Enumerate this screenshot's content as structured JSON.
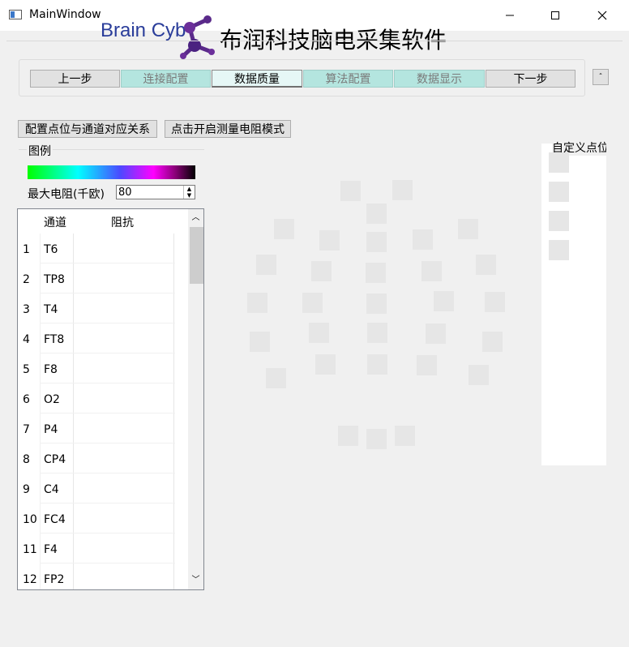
{
  "window": {
    "title": "MainWindow",
    "logo_text": "Brain Cyb",
    "app_heading": "布润科技脑电采集软件"
  },
  "steps": [
    {
      "label": "上一步"
    },
    {
      "label": "连接配置"
    },
    {
      "label": "数据质量"
    },
    {
      "label": "算法配置"
    },
    {
      "label": "数据显示"
    },
    {
      "label": "下一步"
    }
  ],
  "toolbar": {
    "config_button": "配置点位与通道对应关系",
    "impedance_button": "点击开启测量电阻模式",
    "small_button": "ˆ"
  },
  "legend": {
    "title": "图例",
    "max_label": "最大电阻(千欧)",
    "max_value": "80"
  },
  "table": {
    "headers": [
      "通道",
      "阻抗"
    ],
    "rows": [
      {
        "num": "1",
        "channel": "T6",
        "impedance": ""
      },
      {
        "num": "2",
        "channel": "TP8",
        "impedance": ""
      },
      {
        "num": "3",
        "channel": "T4",
        "impedance": ""
      },
      {
        "num": "4",
        "channel": "FT8",
        "impedance": ""
      },
      {
        "num": "5",
        "channel": "F8",
        "impedance": ""
      },
      {
        "num": "6",
        "channel": "O2",
        "impedance": ""
      },
      {
        "num": "7",
        "channel": "P4",
        "impedance": ""
      },
      {
        "num": "8",
        "channel": "CP4",
        "impedance": ""
      },
      {
        "num": "9",
        "channel": "C4",
        "impedance": ""
      },
      {
        "num": "10",
        "channel": "FC4",
        "impedance": ""
      },
      {
        "num": "11",
        "channel": "F4",
        "impedance": ""
      },
      {
        "num": "12",
        "channel": "FP2",
        "impedance": ""
      }
    ]
  },
  "custom_points": {
    "title": "自定义点位"
  },
  "colors": {
    "tab_inactive": "#b4e5df",
    "tab_active": "#e6f7f6",
    "electrode": "#e6e6e6",
    "logo": "#2a3d9a",
    "logo_mark": "#5a2a8a"
  }
}
